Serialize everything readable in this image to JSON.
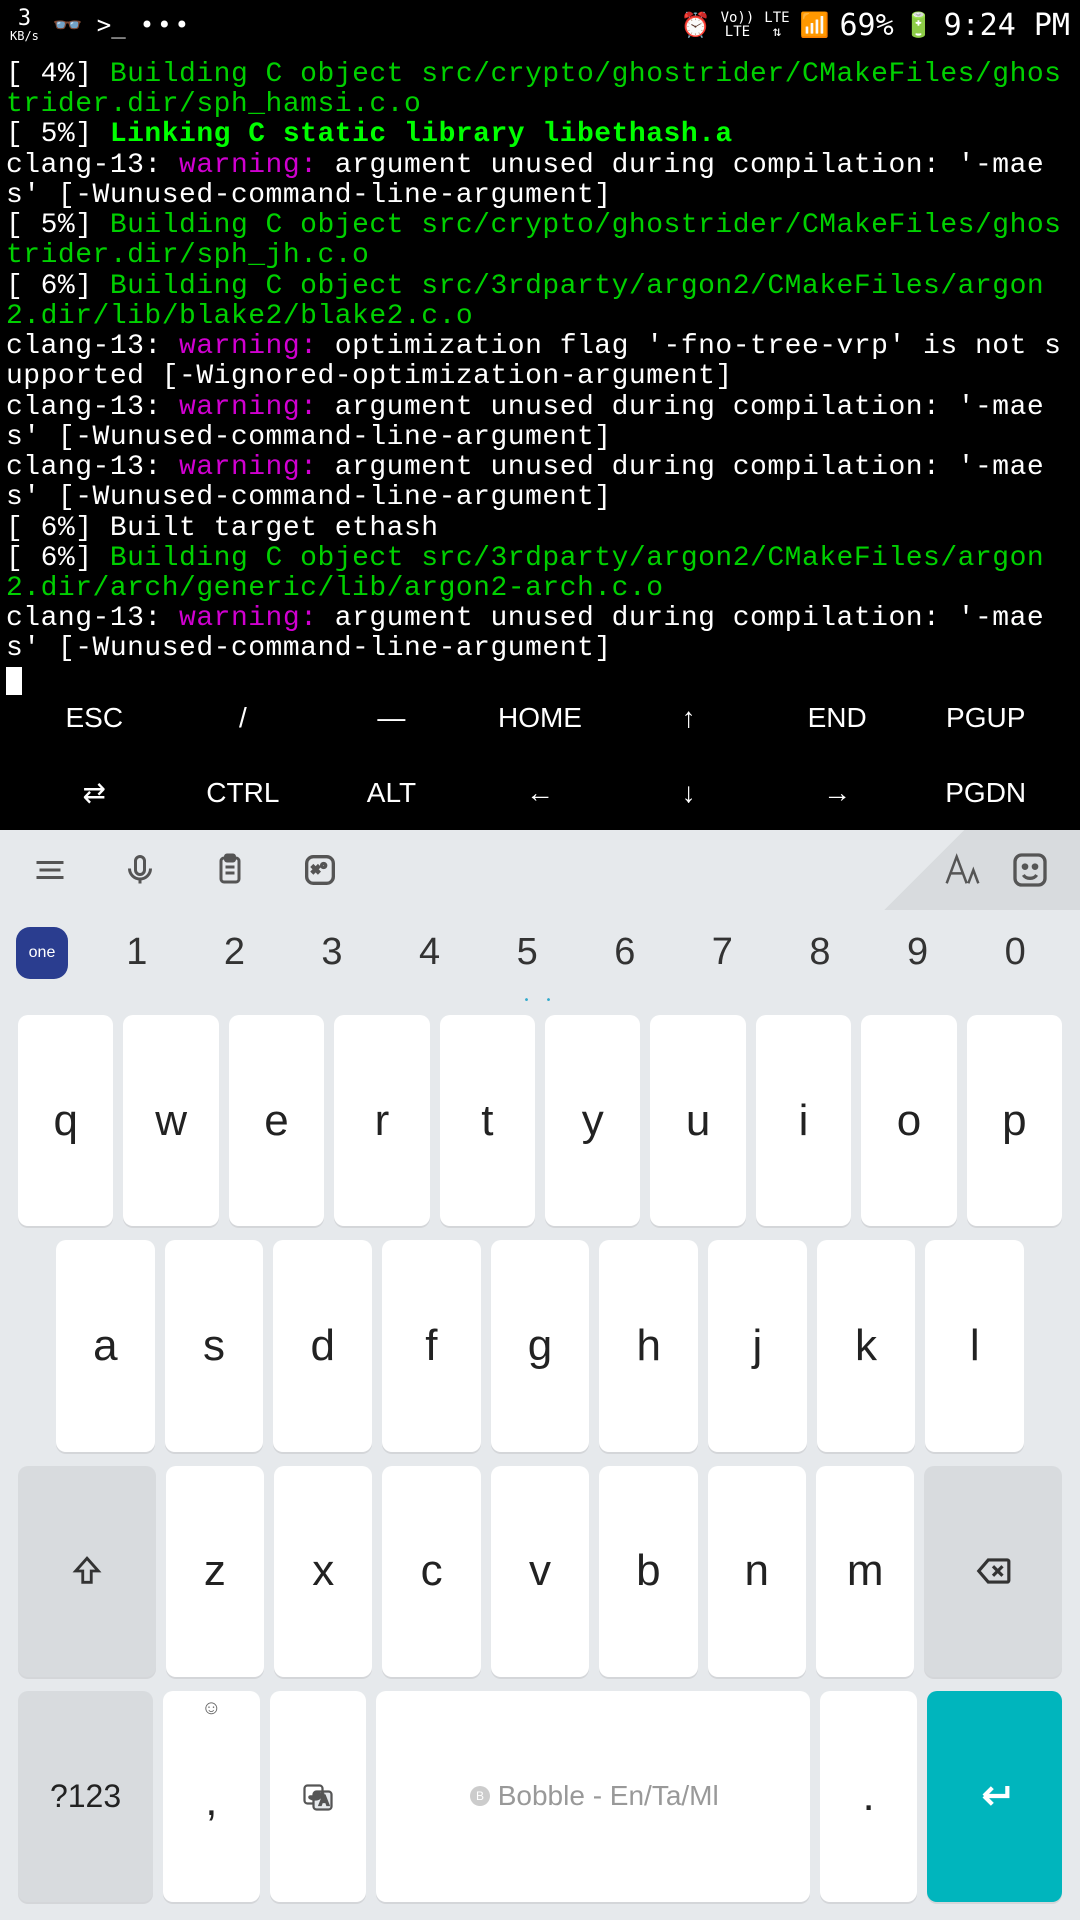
{
  "status_bar": {
    "kbs_num": "3",
    "kbs_unit": "KB/s",
    "dots": "•••",
    "volte_top": "Vo))",
    "volte_bot": "LTE",
    "lte": "LTE",
    "battery_pct": "69%",
    "time": "9:24 PM"
  },
  "terminal_lines": [
    {
      "segments": [
        {
          "text": "[  4%] ",
          "cls": "white"
        },
        {
          "text": "Building C object src/crypto/ghostrider/CMakeFiles/ghostrider.dir/sph_hamsi.c.o",
          "cls": "green"
        }
      ]
    },
    {
      "segments": [
        {
          "text": "[  5%] ",
          "cls": "white"
        },
        {
          "text": "Linking C static library libethash.a",
          "cls": "green-bold"
        }
      ]
    },
    {
      "segments": [
        {
          "text": "clang-13: ",
          "cls": "white"
        },
        {
          "text": "warning: ",
          "cls": "magenta"
        },
        {
          "text": "argument unused during compilation: '-maes' [-Wunused-command-line-argument]",
          "cls": "white"
        }
      ]
    },
    {
      "segments": [
        {
          "text": "[  5%] ",
          "cls": "white"
        },
        {
          "text": "Building C object src/crypto/ghostrider/CMakeFiles/ghostrider.dir/sph_jh.c.o",
          "cls": "green"
        }
      ]
    },
    {
      "segments": [
        {
          "text": "[  6%] ",
          "cls": "white"
        },
        {
          "text": "Building C object src/3rdparty/argon2/CMakeFiles/argon2.dir/lib/blake2/blake2.c.o",
          "cls": "green"
        }
      ]
    },
    {
      "segments": [
        {
          "text": "clang-13: ",
          "cls": "white"
        },
        {
          "text": "warning: ",
          "cls": "magenta"
        },
        {
          "text": "optimization flag '-fno-tree-vrp' is not supported [-Wignored-optimization-argument]",
          "cls": "white"
        }
      ]
    },
    {
      "segments": [
        {
          "text": "clang-13: ",
          "cls": "white"
        },
        {
          "text": "warning: ",
          "cls": "magenta"
        },
        {
          "text": "argument unused during compilation: '-maes' [-Wunused-command-line-argument]",
          "cls": "white"
        }
      ]
    },
    {
      "segments": [
        {
          "text": "clang-13: ",
          "cls": "white"
        },
        {
          "text": "warning: ",
          "cls": "magenta"
        },
        {
          "text": "argument unused during compilation: '-maes' [-Wunused-command-line-argument]",
          "cls": "white"
        }
      ]
    },
    {
      "segments": [
        {
          "text": "[  6%] Built target ethash",
          "cls": "white"
        }
      ]
    },
    {
      "segments": [
        {
          "text": "[  6%] ",
          "cls": "white"
        },
        {
          "text": "Building C object src/3rdparty/argon2/CMakeFiles/argon2.dir/arch/generic/lib/argon2-arch.c.o",
          "cls": "green"
        }
      ]
    },
    {
      "segments": [
        {
          "text": "clang-13: ",
          "cls": "white"
        },
        {
          "text": "warning: ",
          "cls": "magenta"
        },
        {
          "text": "argument unused during compilation: '-maes' [-Wunused-command-line-argument]",
          "cls": "white"
        }
      ]
    }
  ],
  "extra_keys": {
    "row1": [
      "ESC",
      "/",
      "—",
      "HOME",
      "↑",
      "END",
      "PGUP"
    ],
    "row2": [
      "⇄",
      "CTRL",
      "ALT",
      "←",
      "↓",
      "→",
      "PGDN"
    ]
  },
  "keyboard": {
    "one_badge": "one",
    "numbers": [
      "1",
      "2",
      "3",
      "4",
      "5",
      "6",
      "7",
      "8",
      "9",
      "0"
    ],
    "row_q": [
      "q",
      "w",
      "e",
      "r",
      "t",
      "y",
      "u",
      "i",
      "o",
      "p"
    ],
    "row_a": [
      "a",
      "s",
      "d",
      "f",
      "g",
      "h",
      "j",
      "k",
      "l"
    ],
    "row_z": [
      "z",
      "x",
      "c",
      "v",
      "b",
      "n",
      "m"
    ],
    "shift": "⇧",
    "backspace": "⌫",
    "k123": "?123",
    "comma_top": "☺",
    "comma": ",",
    "lang": "🗚",
    "spacebar": "Bobble - En/Ta/Ml",
    "period": ".",
    "enter": "↵"
  }
}
